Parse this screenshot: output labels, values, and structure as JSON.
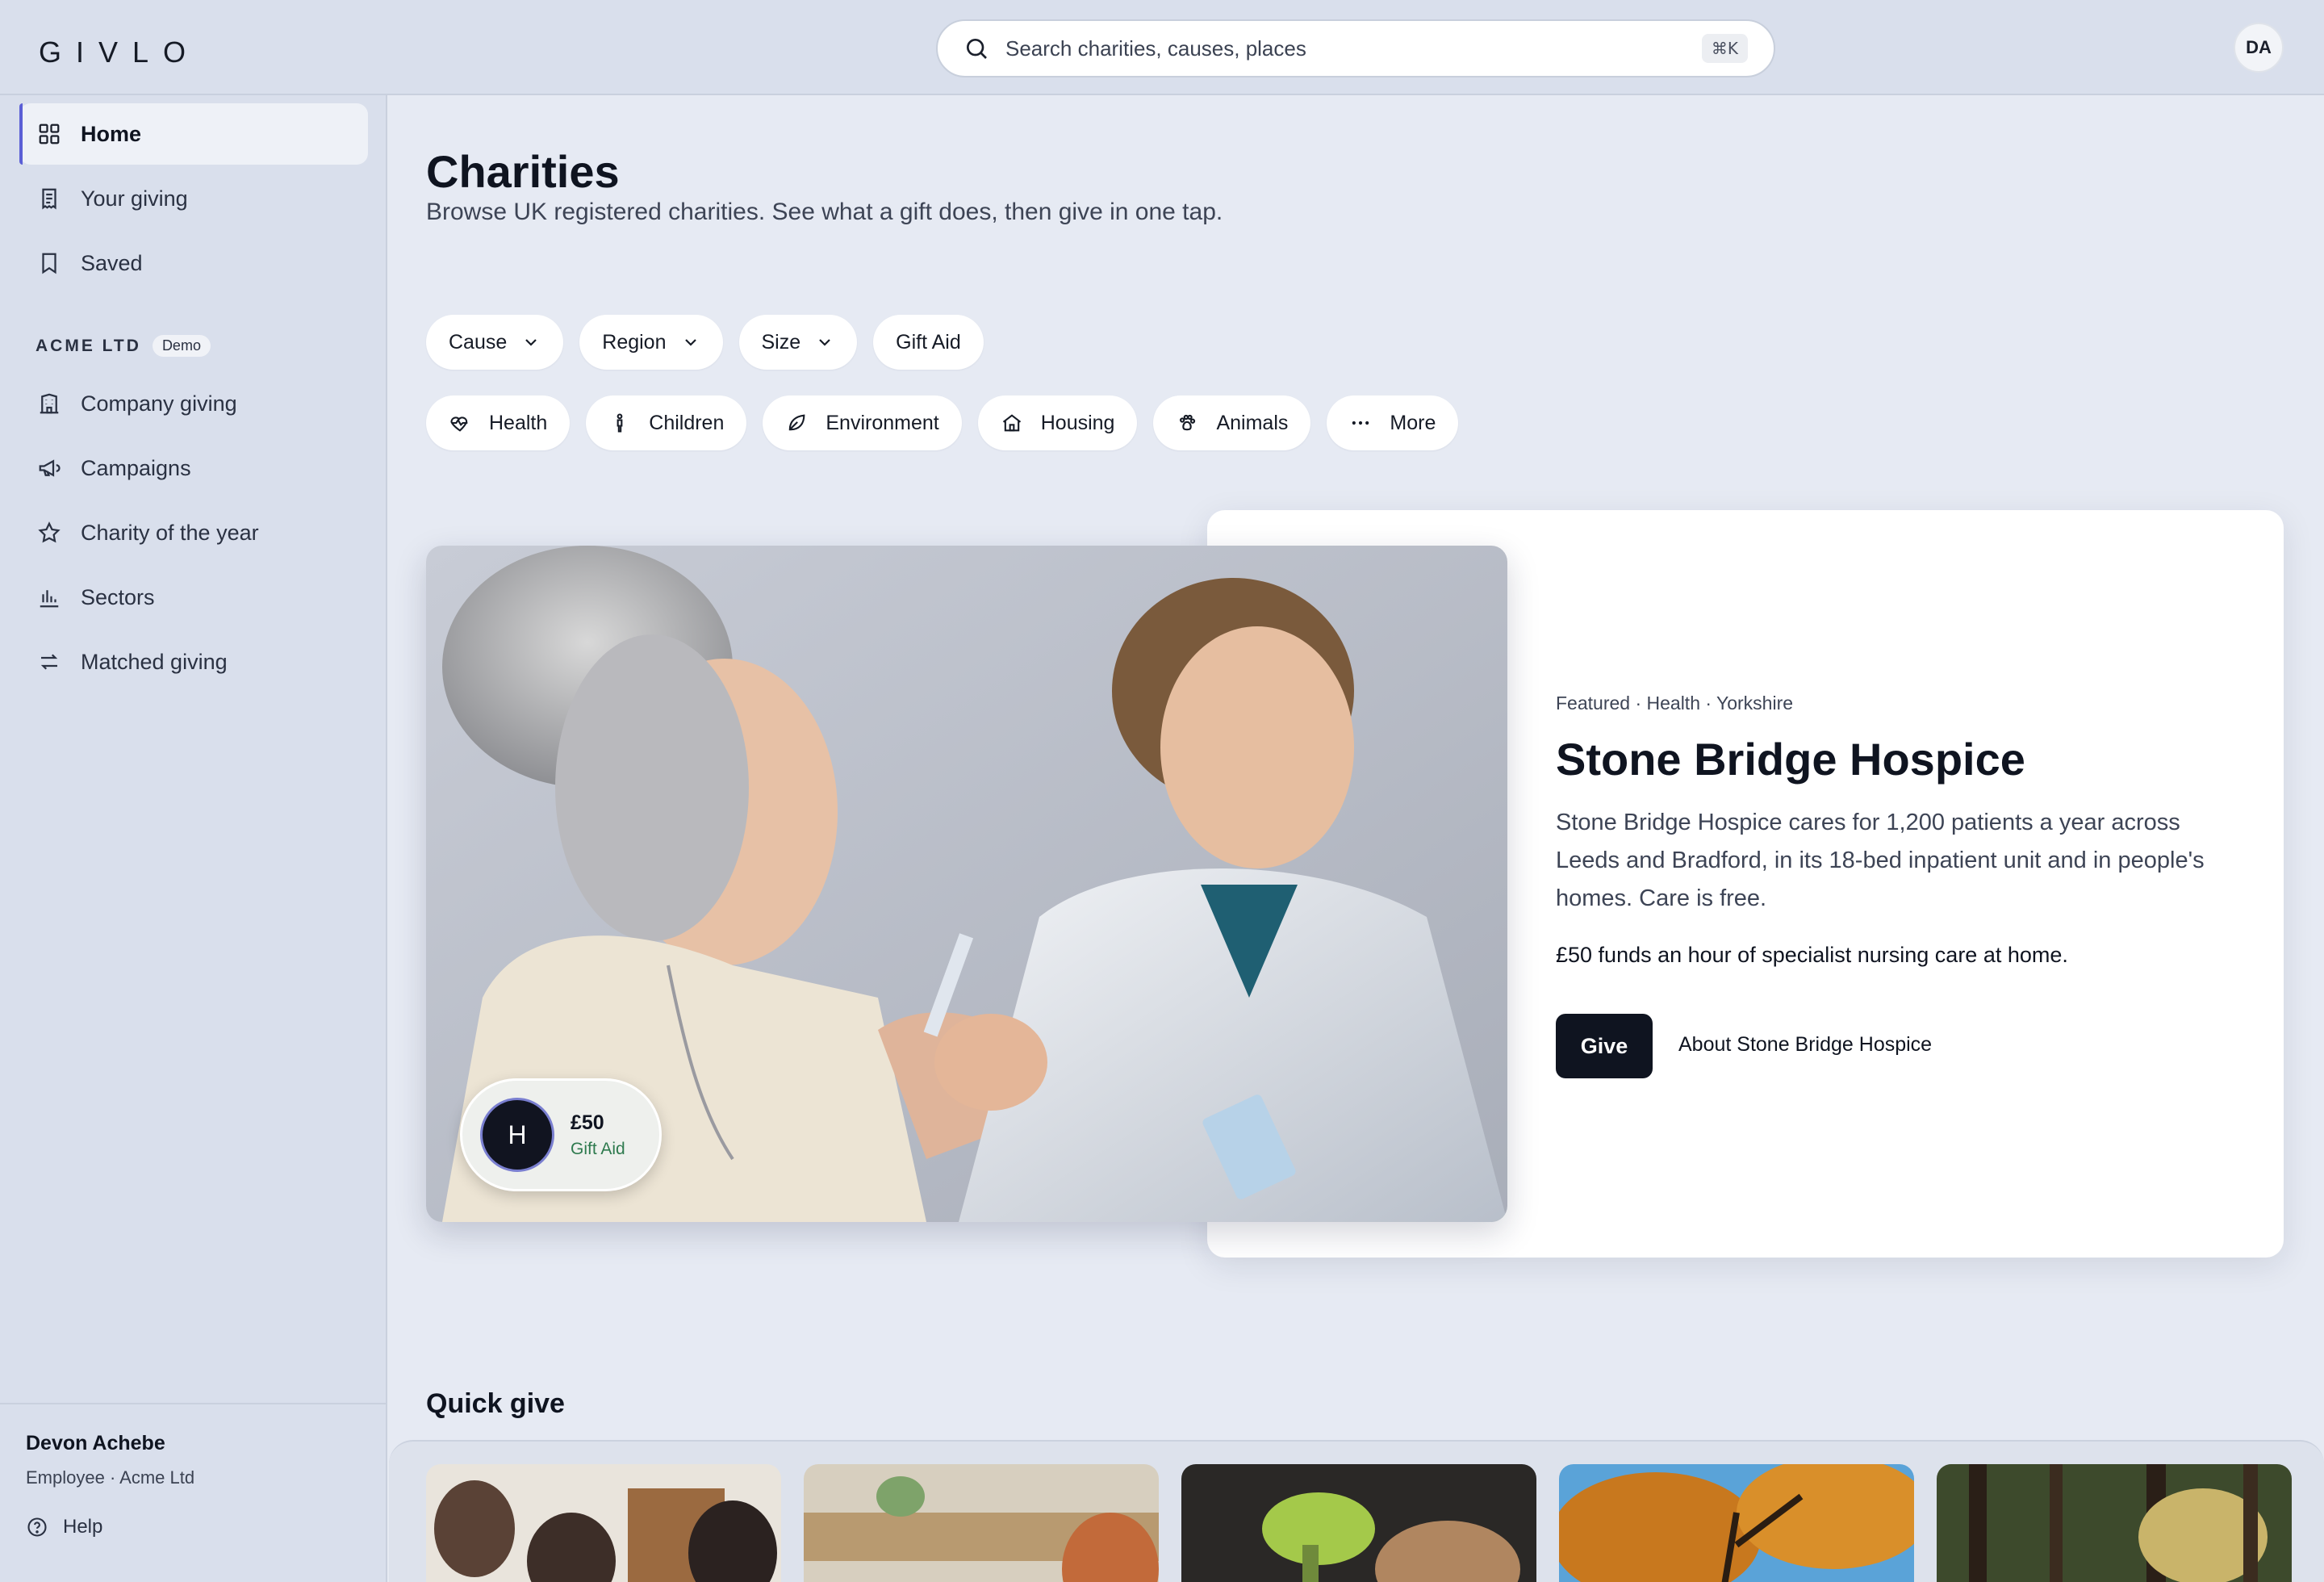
{
  "app": {
    "logo": "GIVLO"
  },
  "search": {
    "placeholder": "Search charities, causes, places",
    "shortcut": "⌘K"
  },
  "user": {
    "initials": "DA",
    "name": "Devon Achebe",
    "role": "Employee · Acme Ltd"
  },
  "sidebar": {
    "primary": [
      {
        "label": "Home",
        "icon": "grid-icon",
        "active": true
      },
      {
        "label": "Your giving",
        "icon": "receipt-icon"
      },
      {
        "label": "Saved",
        "icon": "bookmark-icon"
      }
    ],
    "company_label": "ACME LTD",
    "company_badge": "Demo",
    "company": [
      {
        "label": "Company giving",
        "icon": "building-icon"
      },
      {
        "label": "Campaigns",
        "icon": "megaphone-icon"
      },
      {
        "label": "Charity of the year",
        "icon": "star-icon"
      },
      {
        "label": "Sectors",
        "icon": "bar-chart-icon"
      },
      {
        "label": "Matched giving",
        "icon": "arrows-swap-icon"
      }
    ],
    "help": "Help"
  },
  "page": {
    "title": "Charities",
    "subtitle": "Browse UK registered charities. See what a gift does, then give in one tap."
  },
  "filters": [
    {
      "label": "Cause",
      "dropdown": true
    },
    {
      "label": "Region",
      "dropdown": true
    },
    {
      "label": "Size",
      "dropdown": true
    },
    {
      "label": "Gift Aid",
      "dropdown": false
    }
  ],
  "causes": [
    {
      "label": "Health",
      "icon": "heart-pulse-icon"
    },
    {
      "label": "Children",
      "icon": "child-icon"
    },
    {
      "label": "Environment",
      "icon": "leaf-icon"
    },
    {
      "label": "Housing",
      "icon": "house-icon"
    },
    {
      "label": "Animals",
      "icon": "paw-icon"
    },
    {
      "label": "More",
      "icon": "more-dots-icon"
    }
  ],
  "featured": {
    "meta": "Featured · Health · Yorkshire",
    "title": "Stone Bridge Hospice",
    "description": "Stone Bridge Hospice cares for 1,200 patients a year across Leeds and Bradford, in its 18-bed inpatient unit and in people's homes. Care is free.",
    "impact": "£50 funds an hour of specialist nursing care at home.",
    "give_label": "Give",
    "about_label": "About Stone Bridge Hospice",
    "pill": {
      "initial": "H",
      "amount": "£50",
      "gift_aid": "Gift Aid"
    }
  },
  "quick_give": {
    "title": "Quick give"
  },
  "colors": {
    "accent": "#5b5fd6",
    "dark": "#0f1420",
    "gift_aid_green": "#2e7a4e",
    "background": "#e6eaf3"
  }
}
